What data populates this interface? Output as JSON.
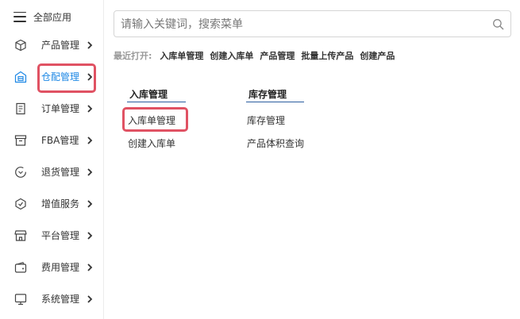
{
  "sidebar": {
    "title": "全部应用",
    "items": [
      {
        "label": "产品管理",
        "icon": "cube-icon"
      },
      {
        "label": "仓配管理",
        "icon": "warehouse-icon",
        "active": true
      },
      {
        "label": "订单管理",
        "icon": "document-icon"
      },
      {
        "label": "FBA管理",
        "icon": "box-icon"
      },
      {
        "label": "退货管理",
        "icon": "return-icon"
      },
      {
        "label": "增值服务",
        "icon": "value-added-icon"
      },
      {
        "label": "平台管理",
        "icon": "store-icon"
      },
      {
        "label": "费用管理",
        "icon": "wallet-icon"
      },
      {
        "label": "系统管理",
        "icon": "monitor-icon"
      }
    ]
  },
  "search": {
    "placeholder": "请输入关键词，搜索菜单"
  },
  "recent": {
    "label": "最近打开:",
    "items": [
      "入库单管理",
      "创建入库单",
      "产品管理",
      "批量上传产品",
      "创建产品"
    ]
  },
  "columns": [
    {
      "title": "入库管理",
      "links": [
        "入库单管理",
        "创建入库单"
      ]
    },
    {
      "title": "库存管理",
      "links": [
        "库存管理",
        "产品体积查询"
      ]
    }
  ],
  "colors": {
    "accent": "#1e88e5",
    "highlight": "#e05263",
    "underline": "#2a5d9f"
  }
}
